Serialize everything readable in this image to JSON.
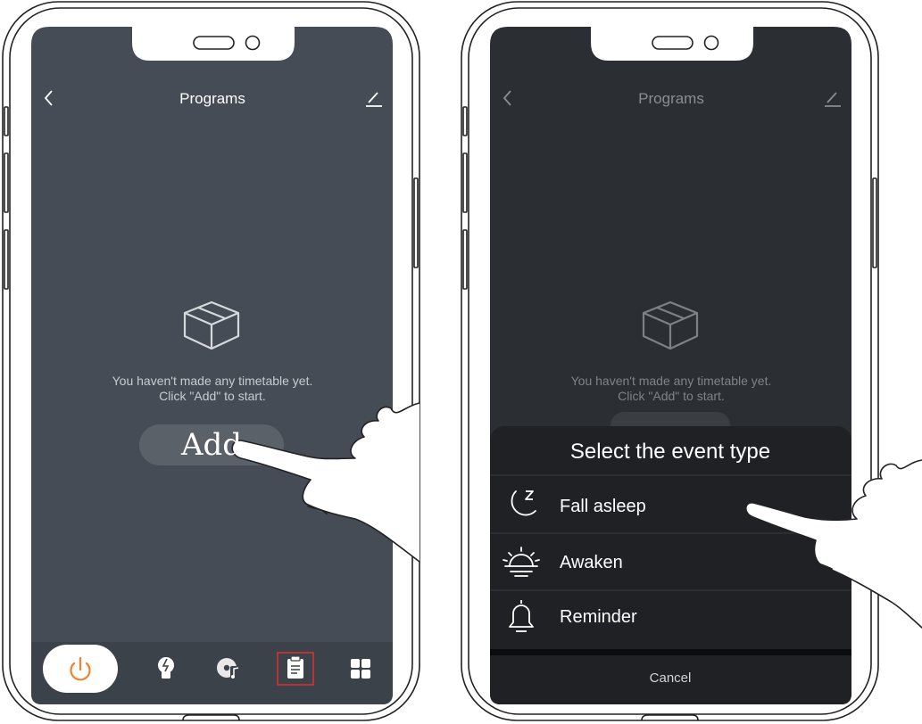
{
  "left_screen": {
    "nav": {
      "title": "Programs",
      "back_icon": "chevron-left-icon",
      "edit_icon": "pencil-icon"
    },
    "empty": {
      "icon": "box-icon",
      "line1": "You haven't made any timetable yet.",
      "line2": "Click \"Add\" to start."
    },
    "add_button": {
      "label": "Add"
    },
    "tab_bar": {
      "tabs": [
        {
          "icon": "power-icon",
          "active": true
        },
        {
          "icon": "bulb-icon",
          "active": false
        },
        {
          "icon": "music-disc-icon",
          "active": false
        },
        {
          "icon": "clipboard-icon",
          "active": false,
          "highlighted": true
        },
        {
          "icon": "grid-icon",
          "active": false
        }
      ]
    }
  },
  "right_screen": {
    "nav": {
      "title": "Programs",
      "back_icon": "chevron-left-icon",
      "edit_icon": "pencil-icon"
    },
    "empty": {
      "icon": "box-icon",
      "line1": "You haven't made any timetable yet.",
      "line2": "Click \"Add\" to start."
    },
    "sheet": {
      "title": "Select the event type",
      "options": [
        {
          "label": "Fall asleep",
          "icon": "moon-sleep-icon"
        },
        {
          "label": "Awaken",
          "icon": "sunrise-icon"
        },
        {
          "label": "Reminder",
          "icon": "bell-icon"
        }
      ],
      "cancel_label": "Cancel"
    }
  },
  "colors": {
    "screen_bg": "#454c55",
    "tab_bar_bg": "#3b4249",
    "sheet_bg": "#1f2124",
    "accent": "#f0832a",
    "highlight": "#e03030"
  }
}
